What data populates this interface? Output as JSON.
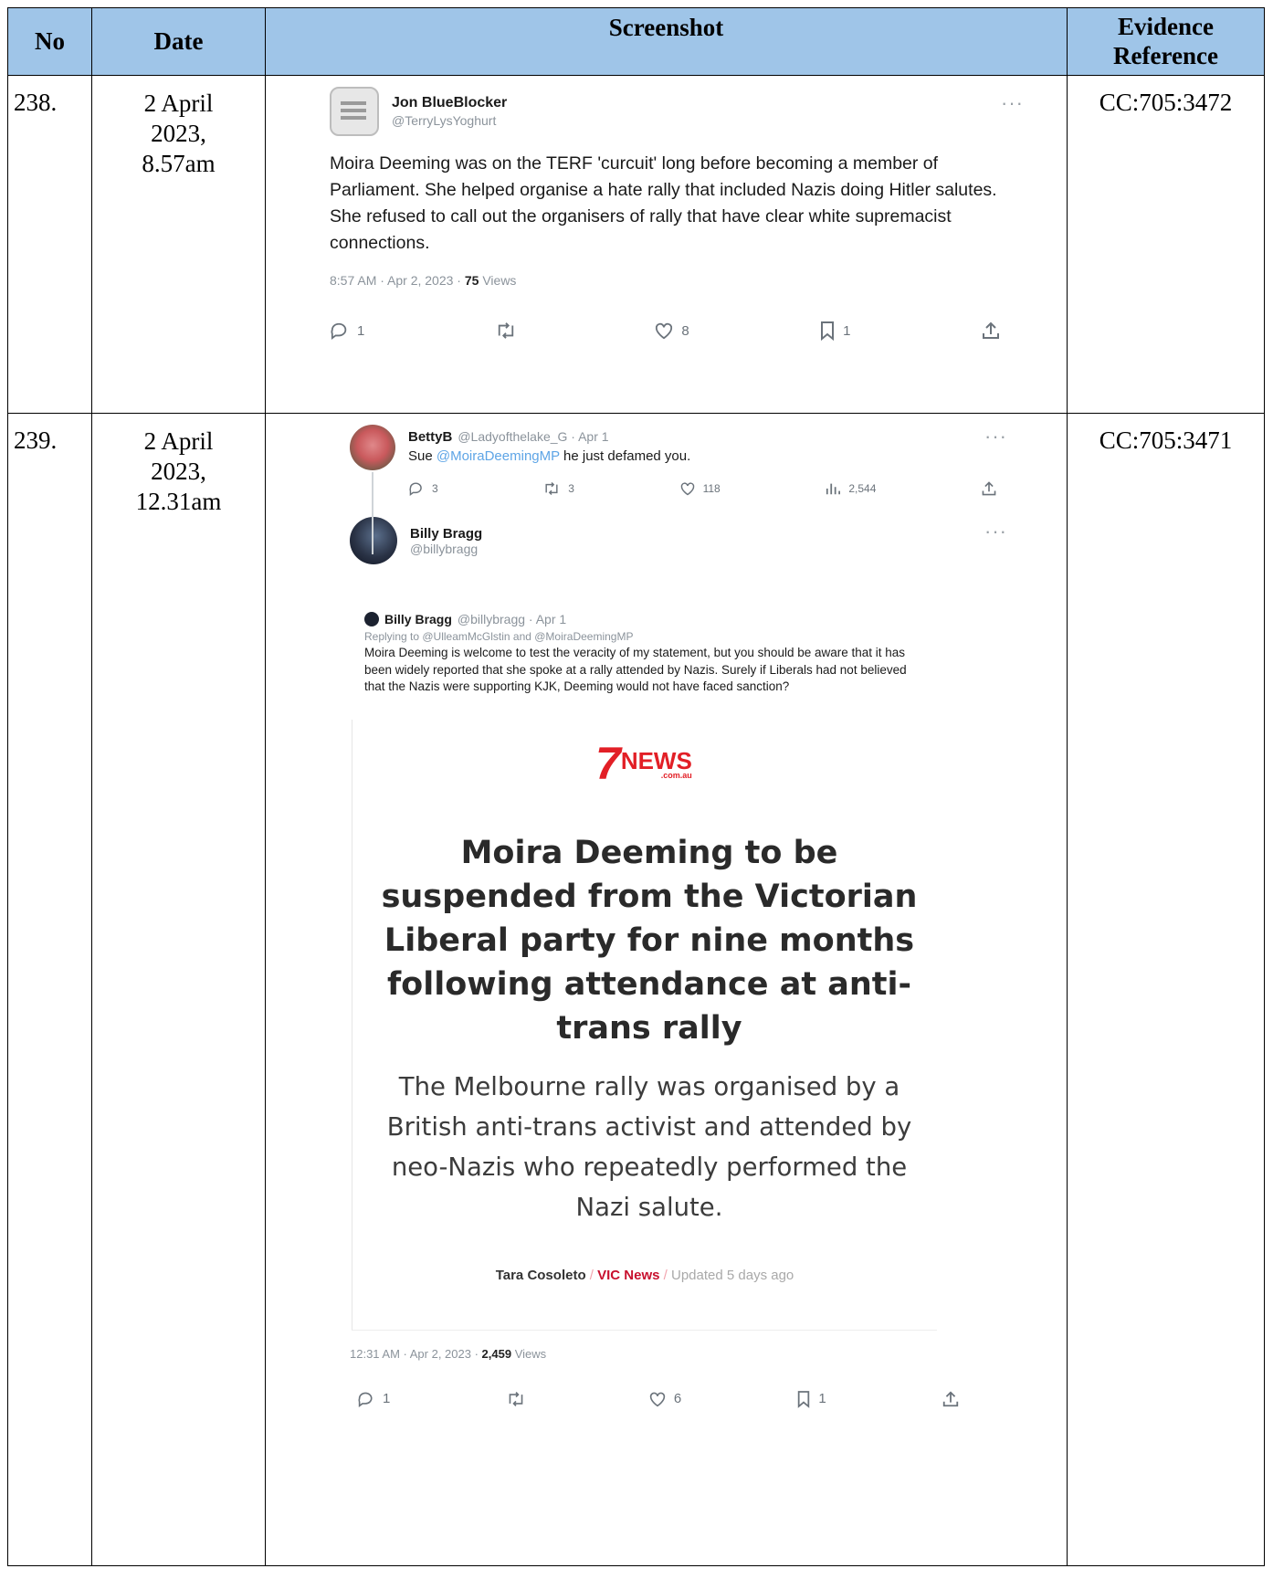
{
  "headers": {
    "no": "No",
    "date": "Date",
    "screenshot": "Screenshot",
    "evidence": "Evidence Reference"
  },
  "rows": [
    {
      "no": "238.",
      "date_lines": [
        "2 April",
        "2023,",
        "8.57am"
      ],
      "evidence_ref": "CC:705:3472",
      "tweet": {
        "display_name": "Jon BlueBlocker",
        "handle": "@TerryLysYoghurt",
        "more": "···",
        "text": "Moira Deeming was on the TERF 'curcuit' long before becoming a member of Parliament. She helped organise a hate rally that included Nazis doing Hitler salutes. She refused to call out the organisers of rally that have clear white supremacist connections.",
        "timestamp": "8:57 AM · Apr 2, 2023 · ",
        "views_count": "75",
        "views_label": " Views",
        "stats": {
          "replies": "1",
          "retweets": "",
          "likes": "8",
          "bookmarks": "1"
        }
      }
    },
    {
      "no": "239.",
      "date_lines": [
        "2 April",
        "2023,",
        "12.31am"
      ],
      "evidence_ref": "CC:705:3471",
      "parent": {
        "display_name": "BettyB",
        "handle_date": "@Ladyofthelake_G · Apr 1",
        "more": "···",
        "text_prefix": "Sue ",
        "mention": "@MoiraDeemingMP",
        "text_suffix": " he just defamed you.",
        "stats": {
          "replies": "3",
          "retweets": "3",
          "likes": "118",
          "views": "2,544"
        }
      },
      "tweet": {
        "display_name": "Billy Bragg",
        "handle": "@billybragg",
        "more": "···",
        "quoted": {
          "display_name": "Billy Bragg",
          "handle_date": "@billybragg · Apr 1",
          "replying": "Replying to @UlleamMcGlstin and @MoiraDeemingMP",
          "text": "Moira Deeming is welcome to test the veracity of my statement, but you should be aware that it has been widely reported that she spoke at a rally attended by Nazis. Surely if Liberals had not believed that the Nazis were supporting KJK, Deeming would not have faced sanction?"
        },
        "article": {
          "logo_number": "7",
          "logo_word": "NEWS",
          "logo_domain": ".com.au",
          "headline": "Moira Deeming to be suspended from the Victorian Liberal party for nine months following attendance at anti-trans rally",
          "subheadline": "The Melbourne rally was organised by a British anti-trans activist and attended by neo-Nazis who repeatedly performed the Nazi salute.",
          "author": "Tara Cosoleto",
          "sep1": " / ",
          "section": "VIC News",
          "sep2": " / ",
          "updated": "Updated 5 days ago"
        },
        "timestamp": "12:31 AM · Apr 2, 2023 · ",
        "views_count": "2,459",
        "views_label": " Views",
        "stats": {
          "replies": "1",
          "retweets": "",
          "likes": "6",
          "bookmarks": "1"
        }
      }
    }
  ],
  "colors": {
    "header_bg": "#9fc5e8",
    "link": "#5ea5e6",
    "news_red": "#e21f26",
    "section_red": "#c8102e"
  },
  "icons": [
    "reply-icon",
    "retweet-icon",
    "like-icon",
    "bookmark-icon",
    "share-icon",
    "views-icon"
  ]
}
